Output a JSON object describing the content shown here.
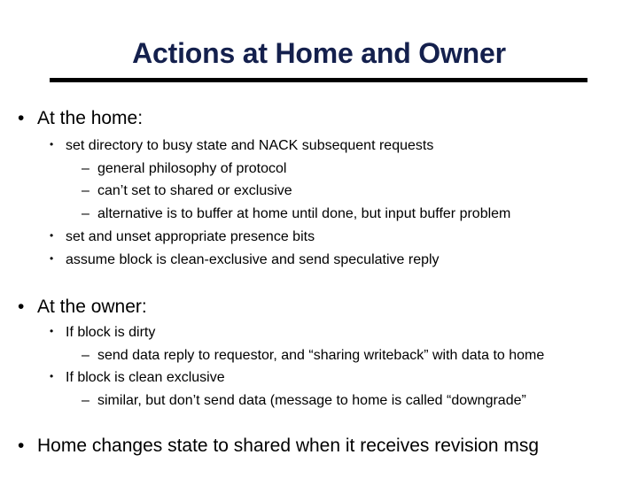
{
  "slide": {
    "title": "Actions at Home and Owner",
    "title_color": "#14204d",
    "bullets": {
      "level1": "•",
      "level2": "•",
      "level3": "–"
    },
    "sections": [
      {
        "heading": "At the home:",
        "items": [
          {
            "text": "set directory to busy state and NACK subsequent requests",
            "subitems": [
              "general philosophy of protocol",
              "can’t set to shared or exclusive",
              "alternative is to buffer at home until done, but input buffer problem"
            ]
          },
          {
            "text": "set and unset appropriate presence bits",
            "subitems": []
          },
          {
            "text": "assume block is clean-exclusive and send speculative reply",
            "subitems": []
          }
        ]
      },
      {
        "heading": "At the owner:",
        "items": [
          {
            "text": "If block is dirty",
            "subitems": [
              "send data reply to requestor, and “sharing writeback” with data to home"
            ]
          },
          {
            "text": "If block is clean exclusive",
            "subitems": [
              "similar, but don’t send data (message to home is called “downgrade”"
            ]
          }
        ]
      },
      {
        "heading": "Home changes state to shared when it receives revision msg",
        "items": []
      }
    ]
  }
}
